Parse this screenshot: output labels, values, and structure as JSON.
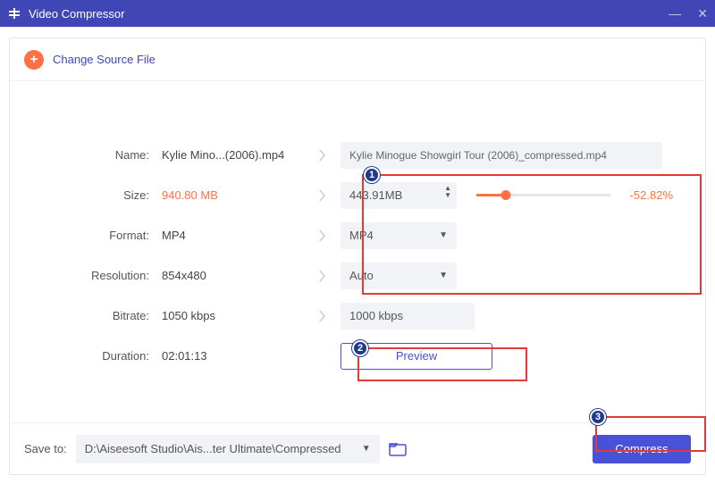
{
  "window": {
    "title": "Video Compressor"
  },
  "header": {
    "change_source": "Change Source File"
  },
  "labels": {
    "name": "Name:",
    "size": "Size:",
    "format": "Format:",
    "resolution": "Resolution:",
    "bitrate": "Bitrate:",
    "duration": "Duration:"
  },
  "source": {
    "name": "Kylie Mino...(2006).mp4",
    "size": "940.80 MB",
    "format": "MP4",
    "resolution": "854x480",
    "bitrate": "1050 kbps",
    "duration": "02:01:13"
  },
  "output": {
    "name": "Kylie Minogue Showgirl Tour (2006)_compressed.mp4",
    "size": "443.91MB",
    "size_reduction_pct": "-52.82%",
    "format": "MP4",
    "resolution": "Auto",
    "bitrate": "1000 kbps"
  },
  "buttons": {
    "preview": "Preview",
    "compress": "Compress"
  },
  "save": {
    "label": "Save to:",
    "path": "D:\\Aiseesoft Studio\\Ais...ter Ultimate\\Compressed"
  },
  "annotations": {
    "n1": "1",
    "n2": "2",
    "n3": "3"
  }
}
